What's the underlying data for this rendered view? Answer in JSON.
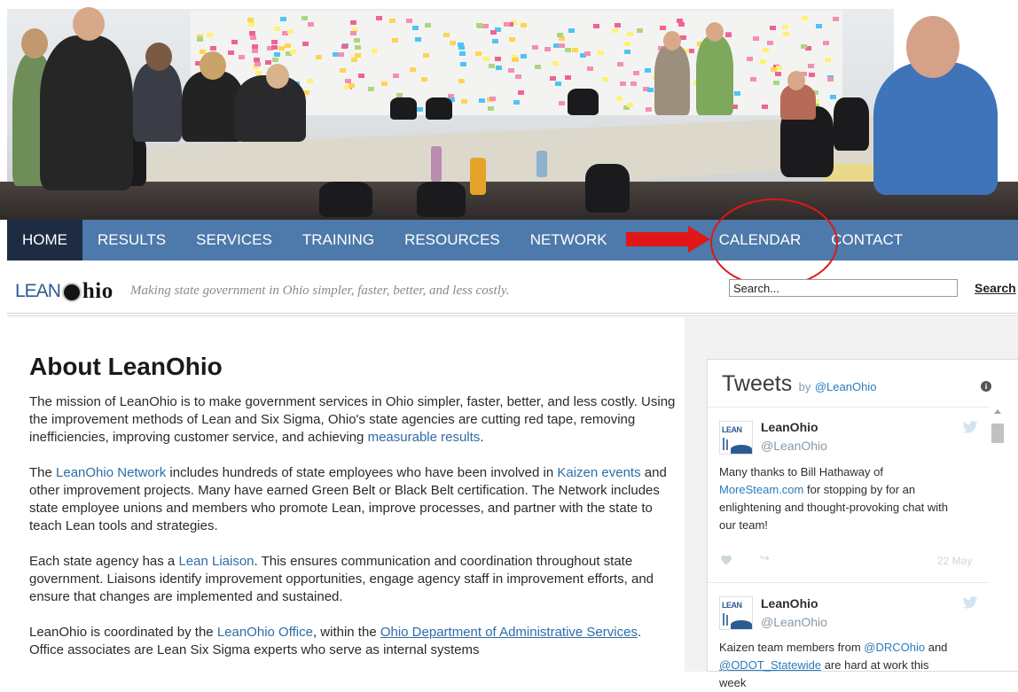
{
  "nav": {
    "items": [
      {
        "label": "HOME",
        "active": true
      },
      {
        "label": "RESULTS",
        "active": false
      },
      {
        "label": "SERVICES",
        "active": false
      },
      {
        "label": "TRAINING",
        "active": false
      },
      {
        "label": "RESOURCES",
        "active": false
      },
      {
        "label": "NETWORK",
        "active": false
      },
      {
        "label": "CALENDAR",
        "active": false
      },
      {
        "label": "CONTACT",
        "active": false
      }
    ],
    "highlighted_item": "CALENDAR",
    "annotation_color": "#e21616"
  },
  "brand": {
    "logo_lean": "LEAN",
    "logo_hio": "hio",
    "tagline": "Making state government in Ohio simpler, faster, better, and less costly."
  },
  "search": {
    "placeholder": "Search...",
    "button_label": "Search"
  },
  "main": {
    "title": "About LeanOhio",
    "p1": {
      "t1": "The mission of LeanOhio is to make government services in Ohio simpler, faster, better, and less costly. Using the improvement methods of Lean and Six Sigma, Ohio's state agencies are cutting red tape, removing inefficiencies, improving customer service, and achieving ",
      "link1": "measurable results",
      "t2": "."
    },
    "p2": {
      "t1": "The ",
      "link1": "LeanOhio Network",
      "t2": " includes hundreds of state employees who have been involved in ",
      "link2": "Kaizen events",
      "t3": " and other improvement projects. Many have earned Green Belt or Black Belt certification. The Network includes state employee unions and members who promote Lean, improve processes, and partner with the state to teach Lean tools and strategies."
    },
    "p3": {
      "t1": "Each state agency has a ",
      "link1": "Lean Liaison",
      "t2": ". This ensures communication and coordination throughout state government. Liaisons identify improvement opportunities, engage agency staff in improvement efforts, and ensure that changes are implemented and sustained."
    },
    "p4": {
      "t1": "LeanOhio is coordinated by the ",
      "link1": "LeanOhio Office",
      "t2": ", within the ",
      "link2": "Ohio Department of Administrative Services",
      "t3": ". Office associates are Lean Six Sigma experts who serve as internal systems"
    }
  },
  "tweets": {
    "title": "Tweets",
    "by": "by",
    "handle": "@LeanOhio",
    "items": [
      {
        "name": "LeanOhio",
        "screen_name": "@LeanOhio",
        "text_1": "Many thanks to Bill Hathaway of ",
        "link_1": "MoreSteam.com",
        "text_2": " for stopping by for an enlightening and thought-provoking chat with our team!",
        "date": "22 May"
      },
      {
        "name": "LeanOhio",
        "screen_name": "@LeanOhio",
        "text_1": "Kaizen team members from ",
        "link_1": "@DRCOhio",
        "text_2": " and ",
        "link_2": "@ODOT_Statewide",
        "text_3": " are hard at work this week"
      }
    ]
  },
  "colors": {
    "nav_bg": "#4d79ab",
    "nav_active_bg": "#1d2c43",
    "link": "#2e6ca8",
    "twitter_link": "#2b7bb9"
  }
}
